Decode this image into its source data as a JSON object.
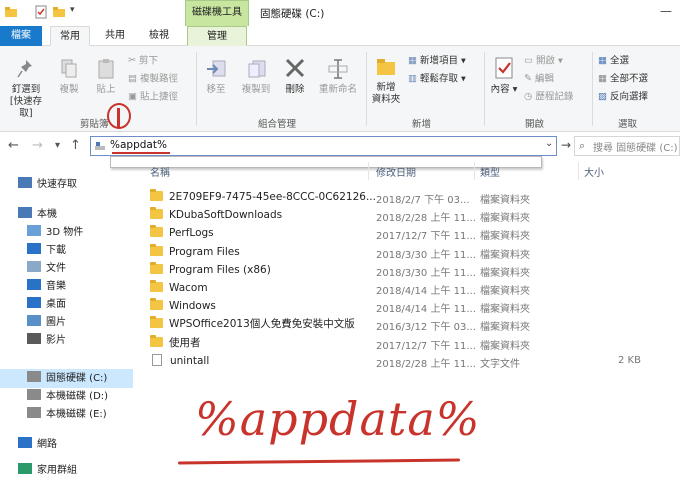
{
  "window": {
    "title": "固態硬碟 (C:)",
    "context_tab": "磁碟機工具"
  },
  "tabs": [
    "檔案",
    "常用",
    "共用",
    "檢視",
    "管理"
  ],
  "ribbon": {
    "pin_label_1": "釘選到",
    "pin_label_2": "[快速存取]",
    "copy": "複製",
    "paste": "貼上",
    "cut": "剪下",
    "copy_path": "複製路徑",
    "paste_shortcut": "貼上捷徑",
    "move_to": "移至",
    "copy_to": "複製到",
    "delete": "刪除",
    "rename": "重新命名",
    "new_folder_1": "新增",
    "new_folder_2": "資料夾",
    "new_item": "新增項目",
    "easy_access": "輕鬆存取",
    "properties": "內容",
    "open": "開啟",
    "edit": "編輯",
    "history": "歷程記錄",
    "select_all": "全選",
    "select_none": "全部不選",
    "invert": "反向選擇",
    "group_clipboard": "剪貼簿",
    "group_organize": "組合管理",
    "group_new": "新增",
    "group_open": "開啟",
    "group_select": "選取"
  },
  "address": {
    "value": "%appdat%",
    "search_placeholder": "搜尋 固態硬碟 (C:)"
  },
  "columns": [
    "名稱",
    "修改日期",
    "類型",
    "大小"
  ],
  "nav": [
    {
      "label": "快速存取",
      "icon": "star-icon"
    },
    {
      "label": "本機",
      "icon": "computer-icon"
    },
    {
      "label": "3D 物件",
      "icon": "cube-icon"
    },
    {
      "label": "下載",
      "icon": "download-icon"
    },
    {
      "label": "文件",
      "icon": "document-icon"
    },
    {
      "label": "音樂",
      "icon": "music-icon"
    },
    {
      "label": "桌面",
      "icon": "desktop-icon"
    },
    {
      "label": "圖片",
      "icon": "picture-icon"
    },
    {
      "label": "影片",
      "icon": "video-icon"
    },
    {
      "label": "固態硬碟 (C:)",
      "icon": "drive-icon"
    },
    {
      "label": "本機磁碟 (D:)",
      "icon": "drive-icon"
    },
    {
      "label": "本機磁碟 (E:)",
      "icon": "drive-icon"
    },
    {
      "label": "網路",
      "icon": "network-icon"
    },
    {
      "label": "家用群組",
      "icon": "homegroup-icon"
    }
  ],
  "files": [
    {
      "name": "2E709EF9-7475-45ee-8CCC-0C62126...",
      "date": "2018/2/7 下午 03...",
      "type": "檔案資料夾",
      "size": "",
      "kind": "folder"
    },
    {
      "name": "KDubaSoftDownloads",
      "date": "2018/2/28 上午 11...",
      "type": "檔案資料夾",
      "size": "",
      "kind": "folder"
    },
    {
      "name": "PerfLogs",
      "date": "2017/12/7 下午 11...",
      "type": "檔案資料夾",
      "size": "",
      "kind": "folder"
    },
    {
      "name": "Program Files",
      "date": "2018/3/30 上午 11...",
      "type": "檔案資料夾",
      "size": "",
      "kind": "folder"
    },
    {
      "name": "Program Files (x86)",
      "date": "2018/3/30 上午 11...",
      "type": "檔案資料夾",
      "size": "",
      "kind": "folder"
    },
    {
      "name": "Wacom",
      "date": "2018/4/14 上午 11...",
      "type": "檔案資料夾",
      "size": "",
      "kind": "folder"
    },
    {
      "name": "Windows",
      "date": "2018/4/14 上午 11...",
      "type": "檔案資料夾",
      "size": "",
      "kind": "folder"
    },
    {
      "name": "WPSOffice2013個人免費免安裝中文版",
      "date": "2016/3/12 下午 03...",
      "type": "檔案資料夾",
      "size": "",
      "kind": "folder"
    },
    {
      "name": "使用者",
      "date": "2017/12/7 下午 11...",
      "type": "檔案資料夾",
      "size": "",
      "kind": "folder"
    },
    {
      "name": "unintall",
      "date": "2018/2/28 上午 11...",
      "type": "文字文件",
      "size": "2 KB",
      "kind": "file"
    }
  ],
  "annotation": {
    "handwritten": "%appdata%",
    "circled_number": "1"
  },
  "colors": {
    "file_tab": "#1979ca",
    "context_green": "#c8e6a0",
    "selection": "#cce8ff",
    "annotation_red": "#c8342c"
  }
}
